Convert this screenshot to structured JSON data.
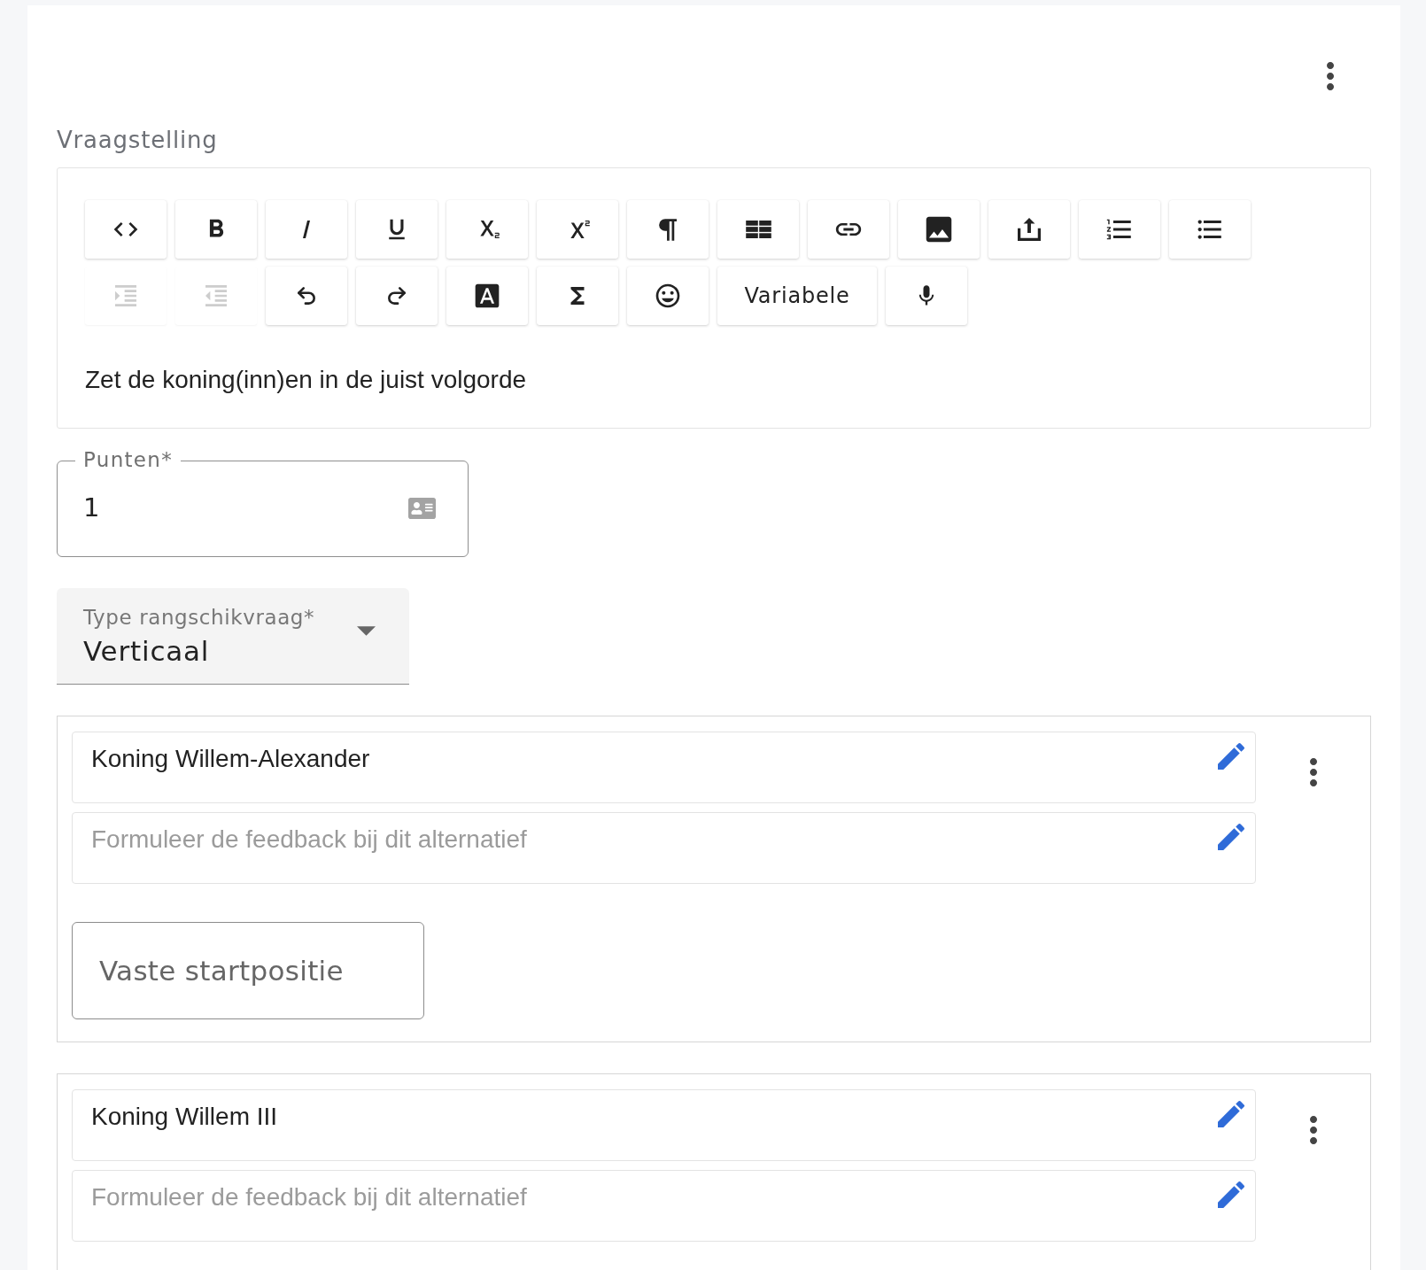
{
  "question": {
    "label": "Vraagstelling",
    "toolbar_rows": [
      [
        {
          "kind": "code",
          "disabled": false
        },
        {
          "kind": "bold",
          "disabled": false
        },
        {
          "kind": "italic",
          "disabled": false
        },
        {
          "kind": "underline",
          "disabled": false
        },
        {
          "kind": "subscript",
          "disabled": false
        },
        {
          "kind": "superscript",
          "disabled": false
        },
        {
          "kind": "paragraph",
          "disabled": false
        },
        {
          "kind": "table",
          "disabled": false
        },
        {
          "kind": "link",
          "disabled": false
        },
        {
          "kind": "image",
          "disabled": false
        },
        {
          "kind": "upload",
          "disabled": false
        },
        {
          "kind": "numbered",
          "disabled": false
        },
        {
          "kind": "bulleted",
          "disabled": false
        }
      ],
      [
        {
          "kind": "indent",
          "disabled": true
        },
        {
          "kind": "outdent",
          "disabled": true
        },
        {
          "kind": "undo",
          "disabled": false
        },
        {
          "kind": "redo",
          "disabled": false
        },
        {
          "kind": "color",
          "disabled": false
        },
        {
          "kind": "formula",
          "disabled": false
        },
        {
          "kind": "emoji",
          "disabled": false
        },
        {
          "kind": "variable",
          "label": "Variabele",
          "disabled": false
        },
        {
          "kind": "mic",
          "disabled": false
        }
      ]
    ],
    "text": "Zet de koning(inn)en in de juist volgorde"
  },
  "points_field": {
    "label": "Punten*",
    "value": "1"
  },
  "type_select": {
    "label": "Type rangschikvraag*",
    "value": "Verticaal"
  },
  "alternatives": [
    {
      "answer": {
        "value": "Koning Willem-Alexander"
      },
      "feedback": {
        "placeholder": "Formuleer de feedback bij dit alternatief"
      },
      "fixed_start_button": "Vaste startpositie"
    },
    {
      "answer": {
        "value": "Koning Willem III"
      },
      "feedback": {
        "placeholder": "Formuleer de feedback bij dit alternatief"
      }
    }
  ]
}
